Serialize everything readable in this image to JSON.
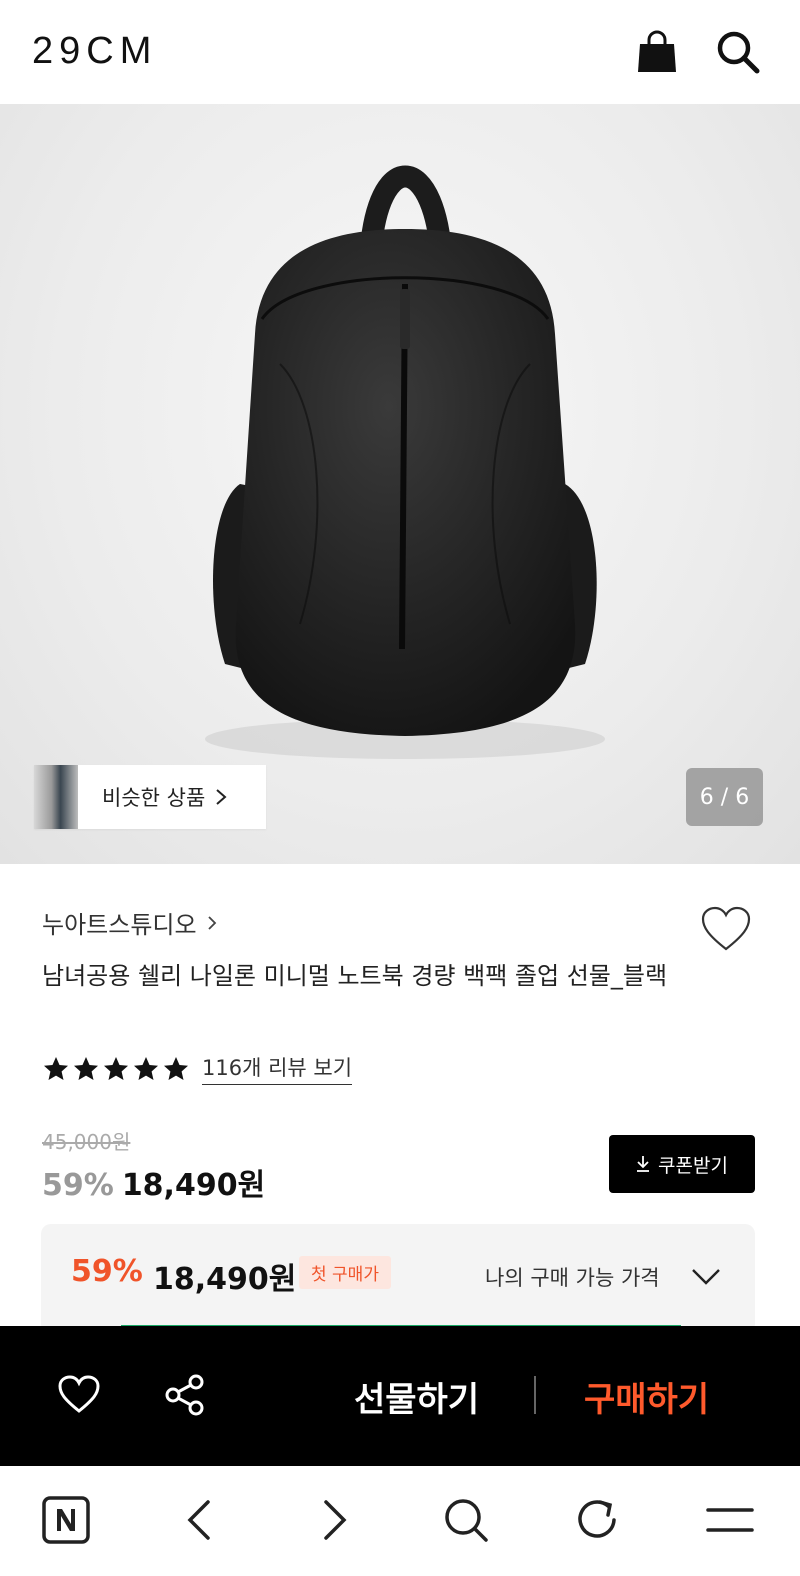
{
  "header": {
    "logo": "29CM",
    "icons": [
      "shopping-bag-icon",
      "search-icon"
    ]
  },
  "hero": {
    "similar_label": "비슷한 상품",
    "counter": "6 / 6"
  },
  "product": {
    "brand": "누아트스튜디오",
    "title": "남녀공용 쉘리 나일론 미니멀 노트북 경량 백팩 졸업 선물_블랙",
    "rating": 5,
    "review_link": "116개 리뷰 보기",
    "original_price": "45,000원",
    "discount": "59%",
    "price": "18,490원",
    "coupon_label": "쿠폰받기"
  },
  "my_price": {
    "discount": "59%",
    "price": "18,490원",
    "badge": "첫 구매가",
    "label": "나의 구매 가능 가격"
  },
  "action_bar": {
    "gift_label": "선물하기",
    "buy_label": "구매하기"
  },
  "colors": {
    "accent": "#ff5a2c",
    "discount": "#f0542a",
    "dark": "#000000"
  }
}
